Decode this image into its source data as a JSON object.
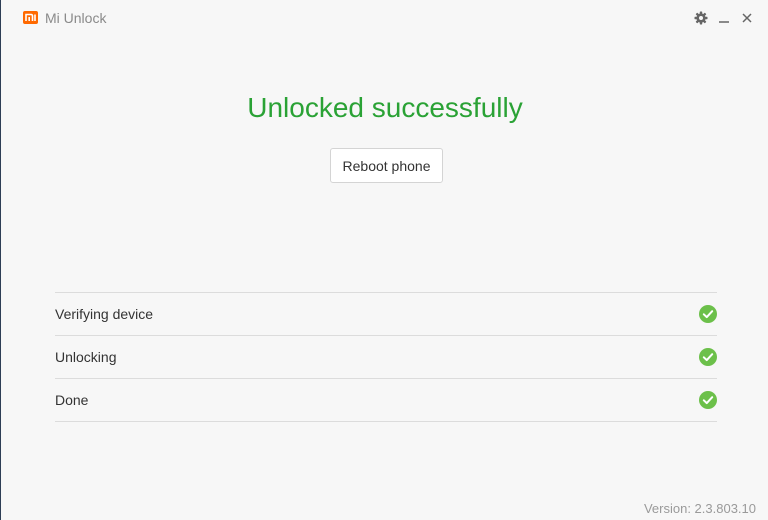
{
  "app": {
    "title": "Mi Unlock",
    "logo_text": "MI",
    "brand_color": "#ff6900"
  },
  "window_controls": {
    "settings_icon": "gear-icon",
    "minimize_icon": "minimize-icon",
    "close_icon": "close-icon"
  },
  "main": {
    "headline": "Unlocked successfully",
    "headline_color": "#2aa235",
    "reboot_button": "Reboot phone"
  },
  "steps": [
    {
      "label": "Verifying device",
      "status": "done",
      "icon": "check-circle-icon"
    },
    {
      "label": "Unlocking",
      "status": "done",
      "icon": "check-circle-icon"
    },
    {
      "label": "Done",
      "status": "done",
      "icon": "check-circle-icon"
    }
  ],
  "status_color": "#6cc04a",
  "footer": {
    "version": "Version: 2.3.803.10"
  }
}
